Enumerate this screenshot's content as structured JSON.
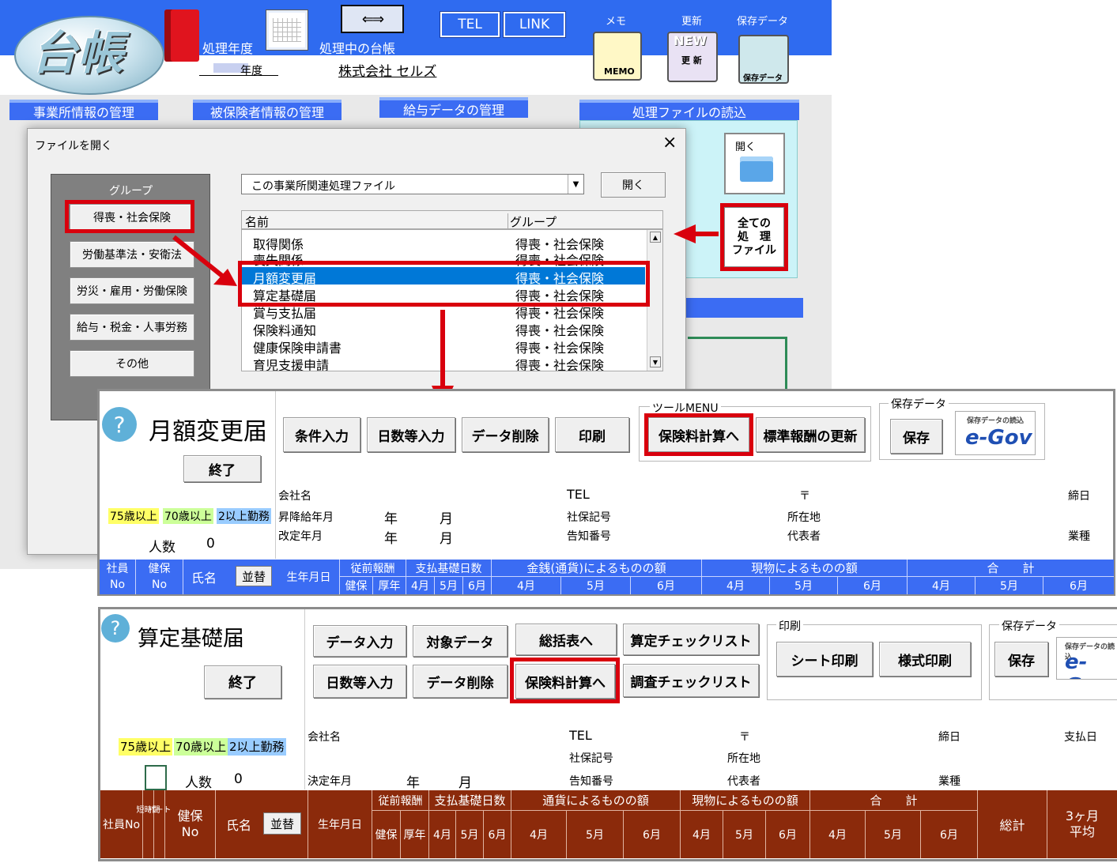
{
  "app": {
    "logo_text": "台帳",
    "year_label": "処理年度",
    "year_value": "年度",
    "current_ledger_label": "処理中の台帳",
    "company_name": "株式会社 セルズ",
    "tel_button": "TEL",
    "link_button": "LINK",
    "memo_caption": "メモ",
    "memo_icon_text": "MEMO",
    "update_caption": "更新",
    "update_icon_top": "NEW",
    "update_icon_text": "更 新",
    "saved_caption": "保存データ",
    "saved_icon_text": "保存データ"
  },
  "tabs": [
    "事業所情報の管理",
    "被保険者情報の管理",
    "給与データの管理",
    "処理ファイルの読込"
  ],
  "right_panel": {
    "open_label": "開く",
    "all_files_label": "全ての\n処　理\nファイル"
  },
  "dialog": {
    "title": "ファイルを開く",
    "close": "×",
    "group_title": "グループ",
    "groups": [
      "得喪・社会保険",
      "労働基準法・安衛法",
      "労災・雇用・労働保険",
      "給与・税金・人事労務",
      "その他"
    ],
    "combo_value": "この事業所関連処理ファイル",
    "open_button": "開く",
    "col_name": "名前",
    "col_group": "グループ",
    "rows": [
      {
        "name": "取得関係",
        "group": "得喪・社会保険"
      },
      {
        "name": "喪失関係",
        "group": "得喪・社会保険"
      },
      {
        "name": "月額変更届",
        "group": "得喪・社会保険"
      },
      {
        "name": "算定基礎届",
        "group": "得喪・社会保険"
      },
      {
        "name": "賞与支払届",
        "group": "得喪・社会保険"
      },
      {
        "name": "保険料通知",
        "group": "得喪・社会保険"
      },
      {
        "name": "健康保険申請書",
        "group": "得喪・社会保険"
      },
      {
        "name": "育児支援申請",
        "group": "得喪・社会保険"
      }
    ]
  },
  "getsugaku": {
    "help": "?",
    "title": "月額変更届",
    "end_button": "終了",
    "buttons": [
      "条件入力",
      "日数等入力",
      "データ削除",
      "印刷"
    ],
    "tool_menu_label": "ツールMENU",
    "tool_buttons": [
      "保険料計算へ",
      "標準報酬の更新"
    ],
    "save_group_label": "保存データ",
    "save_button": "保存",
    "egov_small": "保存データの読込",
    "egov_text": "e-Gov",
    "legend": [
      "75歳以上",
      "70歳以上",
      "2以上勤務"
    ],
    "count_label": "人数",
    "count_value": "0",
    "info": {
      "company": "会社名",
      "tel": "TEL",
      "postal": "〒",
      "cutoff": "締日",
      "raise_month": "昇降給年月",
      "year": "年",
      "month": "月",
      "insurance_code": "社保記号",
      "address": "所在地",
      "revision_month": "改定年月",
      "notice_no": "告知番号",
      "representative": "代表者",
      "industry": "業種"
    },
    "header": {
      "emp_no": [
        "社員",
        "No"
      ],
      "kenpo_no": [
        "健保",
        "No"
      ],
      "name": "氏名",
      "sort": "並替",
      "birth": "生年月日",
      "prev_pay": "従前報酬",
      "kenpo": "健保",
      "kounen": "厚年",
      "pay_days": "支払基礎日数",
      "cash": "金銭(通貨)によるものの額",
      "goods": "現物によるものの額",
      "total": "合　　計",
      "m4": "4月",
      "m5": "5月",
      "m6": "6月"
    }
  },
  "santei": {
    "help": "?",
    "title": "算定基礎届",
    "end_button": "終了",
    "buttons_row1": [
      "データ入力",
      "対象データ",
      "総括表へ",
      "算定チェックリスト"
    ],
    "buttons_row2": [
      "日数等入力",
      "データ削除",
      "保険料計算へ",
      "調査チェックリスト"
    ],
    "print_group_label": "印刷",
    "print_buttons": [
      "シート印刷",
      "様式印刷"
    ],
    "save_group_label": "保存データ",
    "save_button": "保存",
    "egov_small": "保存データの読込",
    "egov_text": "e-Gov",
    "legend": [
      "75歳以上",
      "70歳以上",
      "2以上勤務"
    ],
    "count_label": "人数",
    "count_value": "0",
    "info": {
      "company": "会社名",
      "tel": "TEL",
      "postal": "〒",
      "cutoff": "締日",
      "payday": "支払日",
      "insurance_code": "社保記号",
      "address": "所在地",
      "decision_month": "決定年月",
      "year": "年",
      "month": "月",
      "notice_no": "告知番号",
      "representative": "代表者",
      "industry": "業種"
    },
    "header": {
      "emp_no": "社員No",
      "short_time": "短時間",
      "part": "パート",
      "kenpo_no": [
        "健保",
        "No"
      ],
      "name": "氏名",
      "sort": "並替",
      "birth": "生年月日",
      "prev_pay": "従前報酬",
      "kenpo": "健保",
      "kounen": "厚年",
      "pay_days": "支払基礎日数",
      "cash": "通貨によるものの額",
      "goods": "現物によるものの額",
      "total": "合　　計",
      "grand_total": "総計",
      "avg": [
        "3ヶ月",
        "平均"
      ],
      "m4": "4月",
      "m5": "5月",
      "m6": "6月"
    }
  },
  "colors": {
    "blue": "#3b6cf3",
    "brown": "#8b2a0b",
    "highlight_red": "#d9000d",
    "selected_row": "#0078d7",
    "yellow": "#ffff66",
    "green": "#ccff99",
    "lightblue": "#99ccff"
  }
}
